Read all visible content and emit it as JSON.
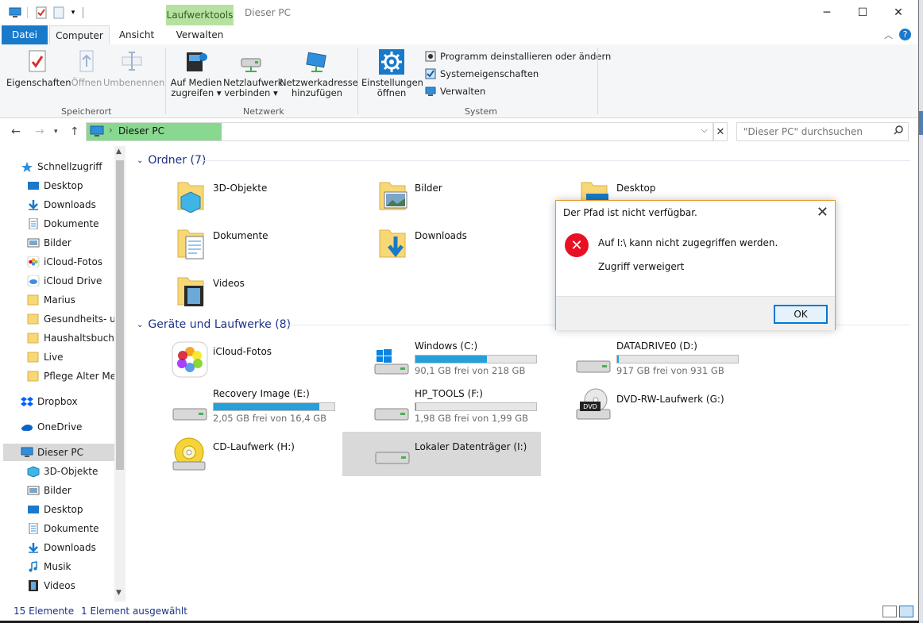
{
  "titlebar": {
    "context_tab": "Laufwerktools",
    "title": "Dieser PC",
    "minimize": "─",
    "maximize": "☐",
    "close": "✕"
  },
  "tabs": [
    {
      "label": "Datei"
    },
    {
      "label": "Computer"
    },
    {
      "label": "Ansicht"
    },
    {
      "label": "Verwalten"
    }
  ],
  "ribbon": {
    "speicherort": {
      "group": "Speicherort",
      "eigenschaften": "Eigenschaften",
      "oeffnen": "Öffnen",
      "umbenennen": "Umbenennen"
    },
    "netzwerk": {
      "group": "Netzwerk",
      "medien_1": "Auf Medien",
      "medien_2": "zugreifen ▾",
      "laufwerk_1": "Netzlaufwerk",
      "laufwerk_2": "verbinden ▾",
      "adresse_1": "Netzwerkadresse",
      "adresse_2": "hinzufügen"
    },
    "system": {
      "group": "System",
      "einstellungen_1": "Einstellungen",
      "einstellungen_2": "öffnen",
      "programm": "Programm deinstallieren oder ändern",
      "systemeigenschaften": "Systemeigenschaften",
      "verwalten": "Verwalten"
    }
  },
  "address": {
    "path": "Dieser PC",
    "search_placeholder": "\"Dieser PC\" durchsuchen"
  },
  "sidebar": {
    "items": [
      {
        "label": "Schnellzugriff"
      },
      {
        "label": "Desktop"
      },
      {
        "label": "Downloads"
      },
      {
        "label": "Dokumente"
      },
      {
        "label": "Bilder"
      },
      {
        "label": "iCloud-Fotos"
      },
      {
        "label": "iCloud Drive"
      },
      {
        "label": "Marius"
      },
      {
        "label": "Gesundheits- un"
      },
      {
        "label": "Haushaltsbuch"
      },
      {
        "label": "Live"
      },
      {
        "label": "Pflege Alter Mer"
      },
      {
        "label": "Dropbox"
      },
      {
        "label": "OneDrive"
      },
      {
        "label": "Dieser PC"
      },
      {
        "label": "3D-Objekte"
      },
      {
        "label": "Bilder"
      },
      {
        "label": "Desktop"
      },
      {
        "label": "Dokumente"
      },
      {
        "label": "Downloads"
      },
      {
        "label": "Musik"
      },
      {
        "label": "Videos"
      }
    ]
  },
  "main": {
    "folders_header": "Ordner (7)",
    "folders": [
      {
        "label": "3D-Objekte"
      },
      {
        "label": "Bilder"
      },
      {
        "label": "Desktop"
      },
      {
        "label": "Dokumente"
      },
      {
        "label": "Downloads"
      },
      {
        "label": "Videos"
      }
    ],
    "drives_header": "Geräte und Laufwerke (8)",
    "drives": [
      {
        "name": "iCloud-Fotos"
      },
      {
        "name": "Windows (C:)",
        "free": "90,1 GB frei von 218 GB",
        "used_fraction": 0.59
      },
      {
        "name": "DATADRIVE0 (D:)",
        "free": "917 GB frei von 931 GB",
        "used_fraction": 0.015
      },
      {
        "name": "Recovery Image (E:)",
        "free": "2,05 GB frei von 16,4 GB",
        "used_fraction": 0.875
      },
      {
        "name": "HP_TOOLS (F:)",
        "free": "1,98 GB frei von 1,99 GB",
        "used_fraction": 0.005
      },
      {
        "name": "DVD-RW-Laufwerk (G:)",
        "dvd_label": "DVD"
      },
      {
        "name": "CD-Laufwerk (H:)"
      },
      {
        "name": "Lokaler Datenträger (I:)"
      }
    ]
  },
  "status": {
    "count": "15 Elemente",
    "selected": "1 Element ausgewählt"
  },
  "dialog": {
    "title": "Der Pfad ist nicht verfügbar.",
    "message": "Auf I:\\ kann nicht zugegriffen werden.",
    "detail": "Zugriff verweigert",
    "ok": "OK"
  },
  "colors": {
    "accent": "#1979ca",
    "context_tab": "#b7e1a1",
    "address_highlight": "#88d890",
    "error": "#e81123",
    "dialog_border": "#e7992c"
  }
}
